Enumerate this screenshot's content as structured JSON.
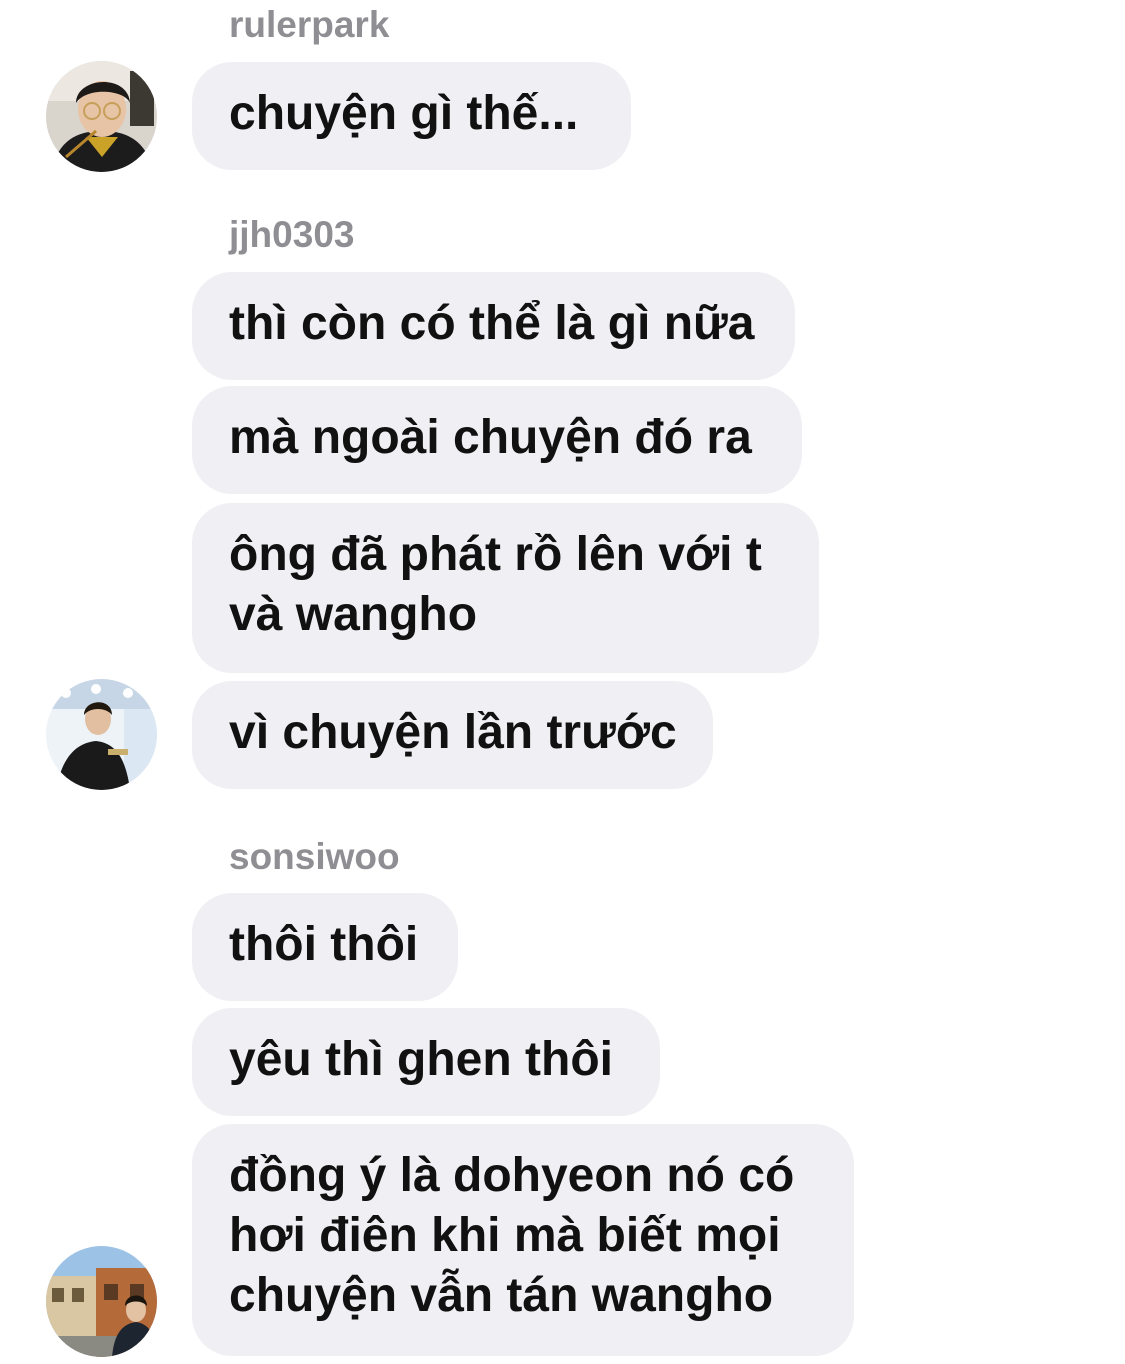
{
  "conversation": {
    "groups": [
      {
        "sender": "rulerpark",
        "avatar": "user-photo-avatar",
        "messages": [
          "chuyện gì thế..."
        ]
      },
      {
        "sender": "jjh0303",
        "avatar": "user-photo-avatar",
        "messages": [
          "thì còn có thể là gì nữa",
          "mà ngoài chuyện đó ra",
          "ông đã phát rồ lên với t\nvà wangho",
          "vì chuyện lần trước"
        ]
      },
      {
        "sender": "sonsiwoo",
        "avatar": "user-photo-avatar",
        "messages": [
          "thôi thôi",
          "yêu thì ghen thôi",
          "đồng ý là dohyeon nó có\nhơi điên khi mà biết mọi\nchuyện vẫn tán wangho"
        ]
      }
    ]
  },
  "colors": {
    "bubble": "#efeff4",
    "sender_name": "#8e8e93",
    "message_text": "#111111",
    "background": "#ffffff"
  }
}
